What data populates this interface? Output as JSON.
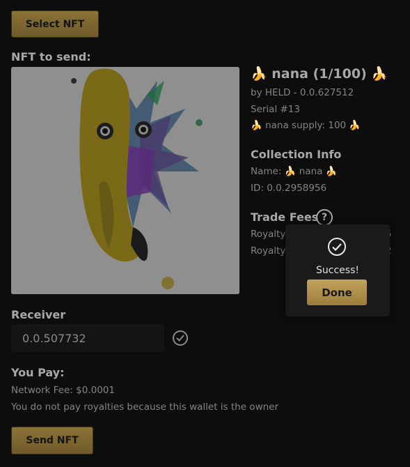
{
  "select_nft_button": "Select NFT",
  "nft_section_label": "NFT to send:",
  "nft": {
    "title": "🍌 nana (1/100) 🍌",
    "creator": "by HELD - 0.0.627512",
    "serial": "Serial #13",
    "supply": "🍌 nana supply: 100 🍌"
  },
  "collection_info": {
    "heading": "Collection Info",
    "name": "Name: 🍌 nana 🍌",
    "id": "ID: 0.0.2958956"
  },
  "trade_fees": {
    "heading": "Trade Fees",
    "help_glyph": "?",
    "royalty_row_1": "Royalty",
    "royalty_row_1_tail": "5",
    "royalty_row_2": "Royalty",
    "royalty_row_2_tail": "2"
  },
  "receiver": {
    "label": "Receiver",
    "value": "0.0.507732"
  },
  "you_pay": {
    "heading": "You Pay:",
    "network_fee": "Network Fee: $0.0001",
    "royalty_note": "You do not pay royalties because this wallet is the owner"
  },
  "send_nft_button": "Send NFT",
  "modal": {
    "message": "Success!",
    "done_label": "Done"
  }
}
